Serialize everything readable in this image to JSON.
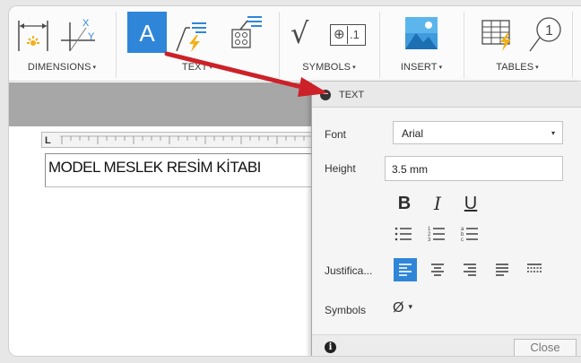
{
  "ribbon": {
    "groups": [
      {
        "label": "DIMENSIONS",
        "icons": [
          "dimension-icon",
          "xy-dimension-icon"
        ]
      },
      {
        "label": "TEXT",
        "icons": [
          "text-icon",
          "leader-text-icon",
          "balloon-icon"
        ]
      },
      {
        "label": "SYMBOLS",
        "icons": [
          "surface-texture-icon",
          "feature-control-frame-icon"
        ]
      },
      {
        "label": "INSERT",
        "icons": [
          "insert-image-icon"
        ]
      },
      {
        "label": "TABLES",
        "icons": [
          "table-icon",
          "balloon-number-icon"
        ]
      }
    ],
    "balloon_number": "1",
    "active_tool": "A",
    "fcf_glyph": "⊕",
    "fcf_text": ".1",
    "sym_glyph": "√"
  },
  "editor": {
    "text": "MODEL MESLEK RESİM KİTABI",
    "ruler_tab": "L"
  },
  "dialog": {
    "title": "TEXT",
    "collapse_glyph": "−",
    "font_label": "Font",
    "font_value": "Arial",
    "height_label": "Height",
    "height_value": "3.5 mm",
    "bold": "B",
    "italic": "I",
    "underline": "U",
    "justification_label": "Justifica...",
    "justification_active": "left",
    "symbols_label": "Symbols",
    "symbols_value": "Ø",
    "close_label": "Close",
    "info_glyph": "i"
  },
  "colors": {
    "accent": "#2f86d8",
    "callout_arrow": "#cc2129",
    "ribbon_icon_yellow": "#f2b018"
  },
  "caret": "▾"
}
